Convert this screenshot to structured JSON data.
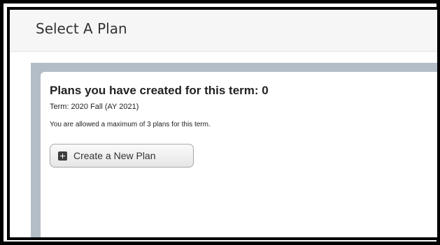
{
  "page": {
    "title": "Select A Plan"
  },
  "plans": {
    "heading": "Plans you have created for this term: 0",
    "term": "Term: 2020 Fall (AY 2021)",
    "limit_notice": "You are allowed a maximum of 3 plans for this term.",
    "create_button": {
      "label": "Create a New Plan",
      "icon": "plus-square-icon"
    }
  },
  "colors": {
    "content_background": "#b3bdc8",
    "frame": "#000000"
  }
}
